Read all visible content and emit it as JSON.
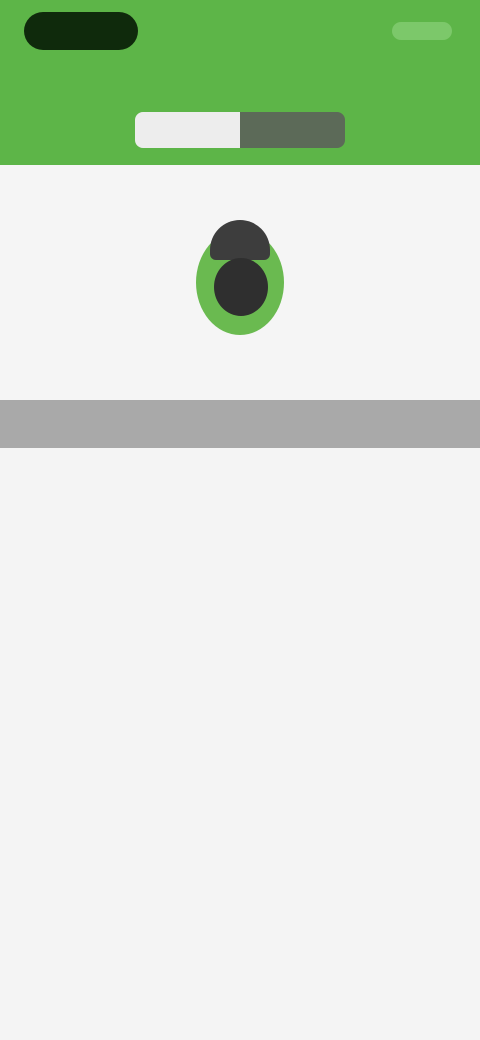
{
  "header": {
    "top_right_action": "",
    "subtext": "",
    "segments": [
      {
        "label": ""
      },
      {
        "label": ""
      }
    ]
  },
  "banner": {
    "text": ""
  },
  "empty_state": {
    "line1": "",
    "line2": ""
  },
  "colors": {
    "brand_green": "#5db548",
    "status_pill": "#0f2a0c",
    "banner_gray": "#a9a9a9",
    "background": "#f3f3f3"
  },
  "icons": {
    "avatar": "android-avatar-icon"
  }
}
